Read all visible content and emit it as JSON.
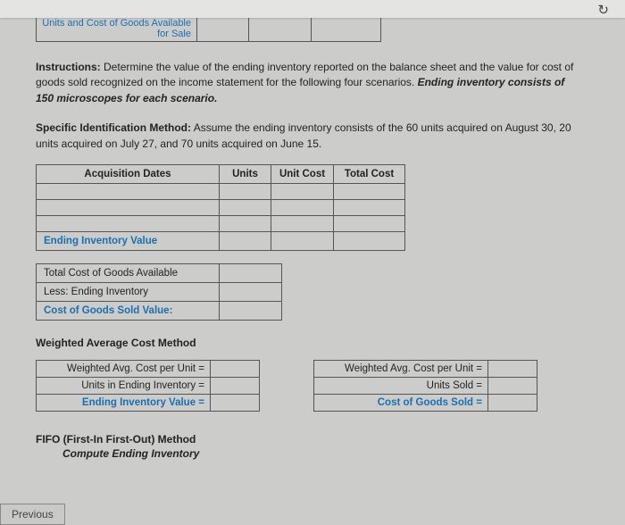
{
  "top_row": {
    "label_line1": "Units and Cost of Goods Available",
    "label_line2": "for Sale"
  },
  "instructions": {
    "lead": "Instructions:",
    "body": "Determine the value of the ending inventory reported on the balance sheet and the value for cost of goods sold recognized on the income statement for the following four scenarios.",
    "tail": "Ending inventory consists of 150 microscopes for each scenario."
  },
  "specific": {
    "lead": "Specific Identification Method:",
    "body": "Assume the ending inventory consists of the 60 units acquired on August 30, 20 units acquired on July 27, and 70 units acquired on June 15."
  },
  "table1": {
    "h1": "Acquisition Dates",
    "h2": "Units",
    "h3": "Unit Cost",
    "h4": "Total Cost",
    "ending": "Ending Inventory Value"
  },
  "table2": {
    "r1": "Total Cost of Goods Available",
    "r2": "Less: Ending Inventory",
    "r3": "Cost of Goods Sold Value:"
  },
  "wavg_heading": "Weighted Average Cost Method",
  "wavg_left": {
    "r1": "Weighted Avg. Cost per Unit =",
    "r2": "Units in Ending Inventory =",
    "r3": "Ending Inventory Value ="
  },
  "wavg_right": {
    "r1": "Weighted Avg. Cost per Unit =",
    "r2": "Units Sold =",
    "r3": "Cost of Goods Sold ="
  },
  "fifo": {
    "heading": "FIFO (First-In First-Out) Method",
    "sub": "Compute Ending Inventory"
  },
  "prev_label": "Previous",
  "icons": {
    "refresh": "↻"
  }
}
